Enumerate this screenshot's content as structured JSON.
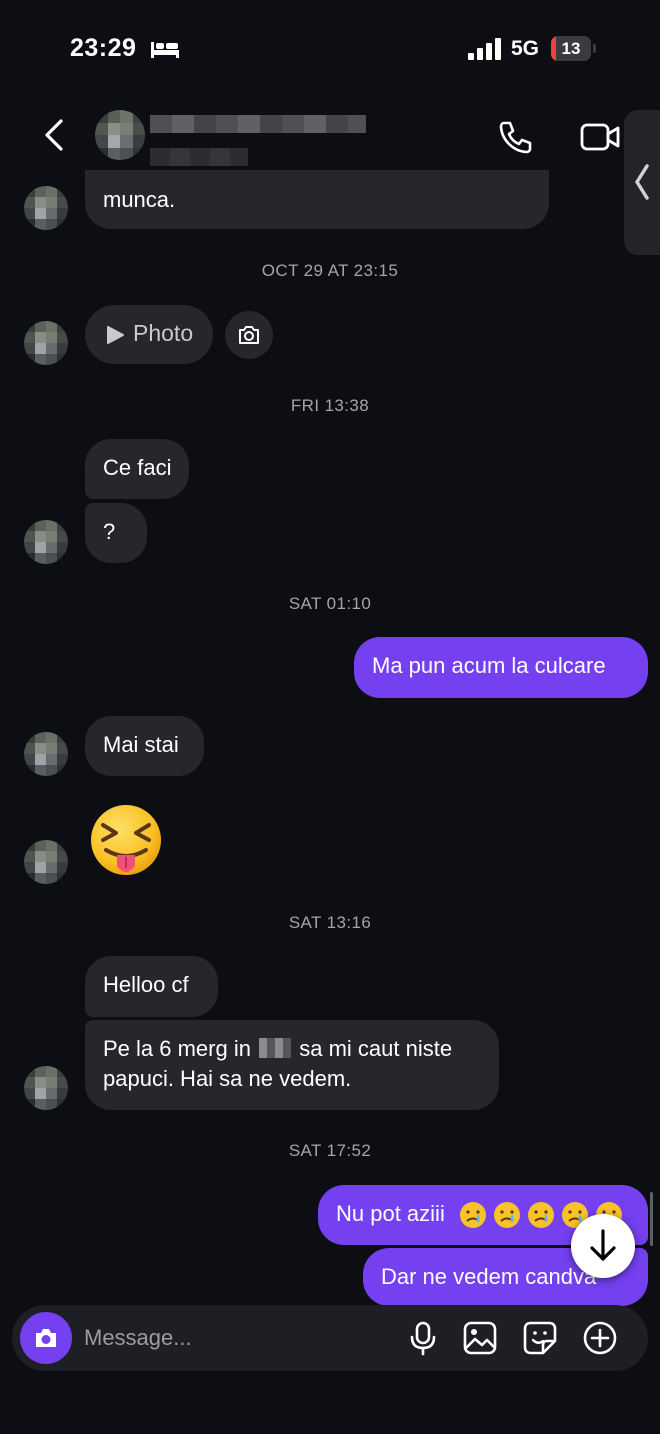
{
  "status_bar": {
    "time": "23:29",
    "network": "5G",
    "battery": "13",
    "battery_level": 0.13,
    "icons": [
      "bed-icon",
      "signal-icon"
    ]
  },
  "header": {
    "icons": [
      "back-icon",
      "phone-icon",
      "video-icon"
    ]
  },
  "messages": {
    "m1": "munca.",
    "sep1": "OCT 29 AT 23:15",
    "photo_label": "Photo",
    "sep2": "FRI 13:38",
    "m2": "Ce faci",
    "m3": "?",
    "sep3": "SAT 01:10",
    "m4": "Ma pun acum la culcare",
    "m5": "Mai stai",
    "m6_emoji": "squinting-face-with-tongue",
    "sep4": "SAT 13:16",
    "m7": "Helloo cf",
    "m8_a": "Pe la 6 merg in",
    "m8_b": "sa mi caut niste",
    "m8_c": "papuci. Hai sa ne vedem.",
    "sep5": "SAT 17:52",
    "m9": "Nu pot aziii",
    "m10": "Dar ne vedem candva"
  },
  "composer": {
    "placeholder": "Message...",
    "icons": [
      "camera-icon",
      "microphone-icon",
      "gallery-icon",
      "sticker-icon",
      "add-icon"
    ]
  },
  "colors": {
    "background": "#0c0e13",
    "incoming_bubble": "#26272c",
    "outgoing_bubble": "#7440f0",
    "battery_low": "#e8443b"
  }
}
